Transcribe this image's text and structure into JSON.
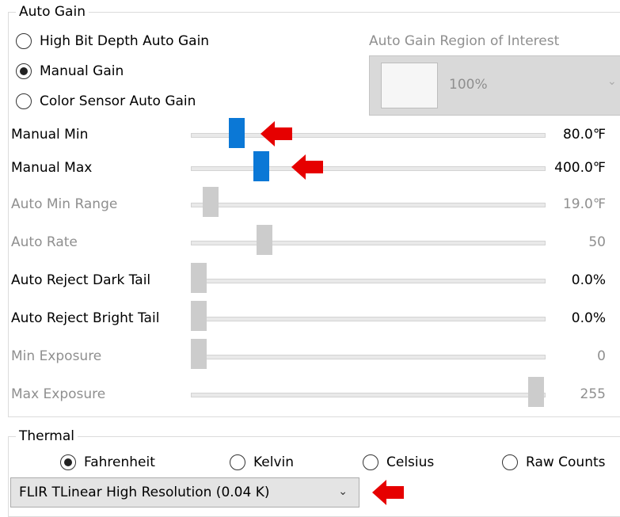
{
  "auto_gain": {
    "title": "Auto Gain",
    "options": [
      {
        "label": "High Bit Depth Auto Gain",
        "selected": false
      },
      {
        "label": "Manual Gain",
        "selected": true
      },
      {
        "label": "Color Sensor Auto Gain",
        "selected": false
      }
    ],
    "roi": {
      "label": "Auto Gain Region of Interest",
      "value": "100%"
    }
  },
  "sliders": [
    {
      "label": "Manual Min",
      "value": "80.0℉",
      "enabled": true
    },
    {
      "label": "Manual Max",
      "value": "400.0℉",
      "enabled": true
    },
    {
      "label": "Auto Min Range",
      "value": "19.0℉",
      "enabled": false
    },
    {
      "label": "Auto Rate",
      "value": "50",
      "enabled": false
    },
    {
      "label": "Auto Reject Dark Tail",
      "value": "0.0%",
      "enabled": true
    },
    {
      "label": "Auto Reject Bright Tail",
      "value": "0.0%",
      "enabled": true
    },
    {
      "label": "Min Exposure",
      "value": "0",
      "enabled": false
    },
    {
      "label": "Max Exposure",
      "value": "255",
      "enabled": false
    }
  ],
  "thermal": {
    "title": "Thermal",
    "units": [
      {
        "label": "Fahrenheit",
        "selected": true
      },
      {
        "label": "Kelvin",
        "selected": false
      },
      {
        "label": "Celsius",
        "selected": false
      },
      {
        "label": "Raw Counts",
        "selected": false
      }
    ],
    "mode_select": {
      "value": "FLIR TLinear High Resolution (0.04 K)"
    }
  },
  "colors": {
    "thumb_active": "#0b78d6",
    "thumb_disabled": "#cccccc",
    "annotation_arrow": "#e60000"
  }
}
